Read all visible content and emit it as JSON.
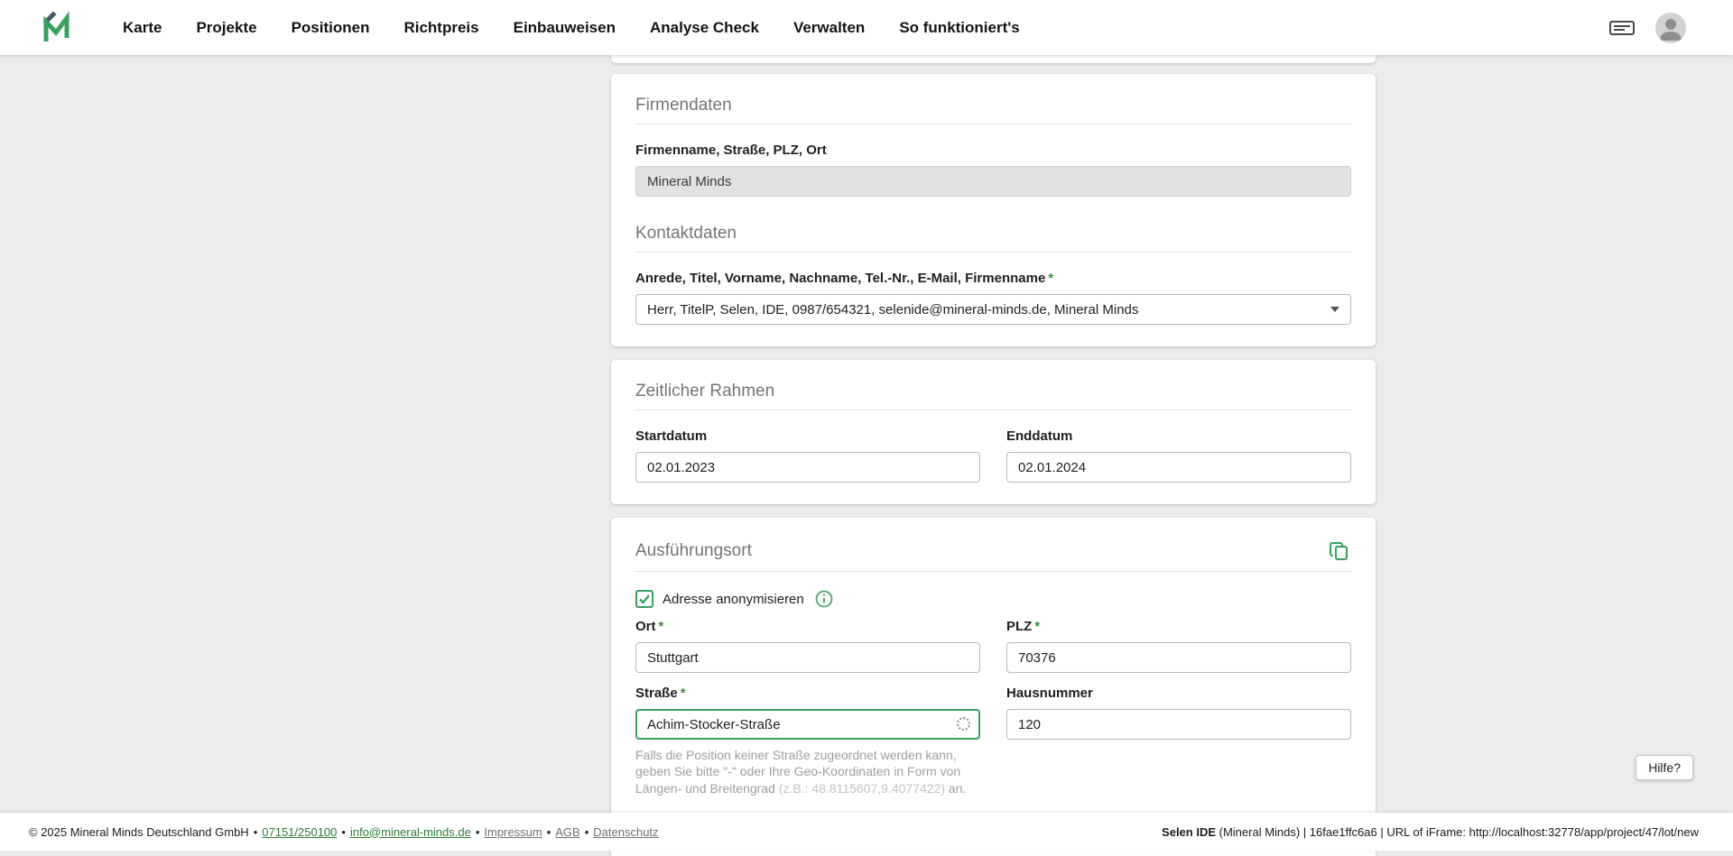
{
  "nav": {
    "items": [
      "Karte",
      "Projekte",
      "Positionen",
      "Richtpreis",
      "Einbauweisen",
      "Analyse Check",
      "Verwalten",
      "So funktioniert's"
    ]
  },
  "required_mark": "*",
  "sections": {
    "firmendaten": {
      "title": "Firmendaten",
      "company_label": "Firmenname, Straße, PLZ, Ort",
      "company_value": "Mineral Minds",
      "kontakt_title": "Kontaktdaten",
      "kontakt_label": "Anrede, Titel, Vorname, Nachname, Tel.-Nr., E-Mail, Firmenname",
      "kontakt_value": "Herr, TitelP, Selen, IDE, 0987/654321, selenide@mineral-minds.de, Mineral Minds"
    },
    "zeitraum": {
      "title": "Zeitlicher Rahmen",
      "start_label": "Startdatum",
      "start_value": "02.01.2023",
      "end_label": "Enddatum",
      "end_value": "02.01.2024"
    },
    "ort": {
      "title": "Ausführungsort",
      "anonymize_label": "Adresse anonymisieren",
      "city_label": "Ort",
      "city_value": "Stuttgart",
      "zip_label": "PLZ",
      "zip_value": "70376",
      "street_label": "Straße",
      "street_value": "Achim-Stocker-Straße",
      "number_label": "Hausnummer",
      "number_value": "120",
      "hint_part1": "Falls die Position keiner Straße zugeordnet werden kann, geben Sie bitte \"-\" oder Ihre Geo-Koordinaten in Form von Längen- und Breitengrad ",
      "hint_example": "(z.B.: 48.8115607,9.4077422)",
      "hint_part2": " an."
    }
  },
  "help_button": "Hilfe?",
  "footer": {
    "copyright": "© 2025 Mineral Minds Deutschland GmbH",
    "separator": "•",
    "phone": "07151/250100",
    "email": "info@mineral-minds.de",
    "impressum": "Impressum",
    "agb": "AGB",
    "datenschutz": "Datenschutz",
    "ide_name": "Selen IDE",
    "ide_rest": " (Mineral Minds) | 16fae1ffc6a6 | URL of iFrame: http://localhost:32778/app/project/47/lot/new"
  },
  "colors": {
    "accent_green": "#3aa05f",
    "link_green": "#2e7d32"
  }
}
